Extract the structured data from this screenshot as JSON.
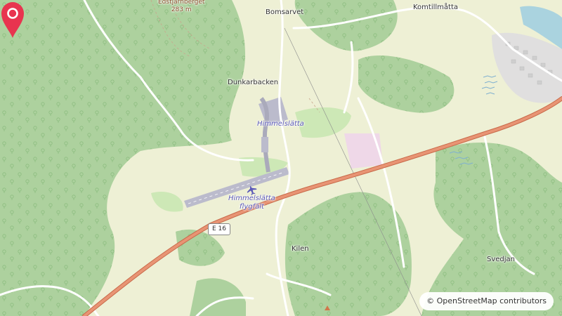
{
  "map": {
    "labels": {
      "peak_name": "Edstjärnberget",
      "peak_elev": "283 m",
      "bomsarvet": "Bomsarvet",
      "komtillmatta": "Komtillmåtta",
      "dunkarbacken": "Dunkarbacken",
      "himmelslatta": "Himmelslätta",
      "airport_l1": "Himmelslätta",
      "airport_l2": "flygfält",
      "kilen": "Kilen",
      "svedjan": "Svedjan"
    },
    "road_shield": "E 16",
    "attribution": "© OpenStreetMap contributors",
    "marker_icon": "map-pin-icon",
    "colors": {
      "forest": "#add19e",
      "farmland": "#eef0d5",
      "grass": "#cde8b6",
      "motorway": "#e89474",
      "road": "#ffffff",
      "marker": "#e8344f",
      "water": "#aad3df",
      "residential": "#e0dfdf"
    }
  }
}
